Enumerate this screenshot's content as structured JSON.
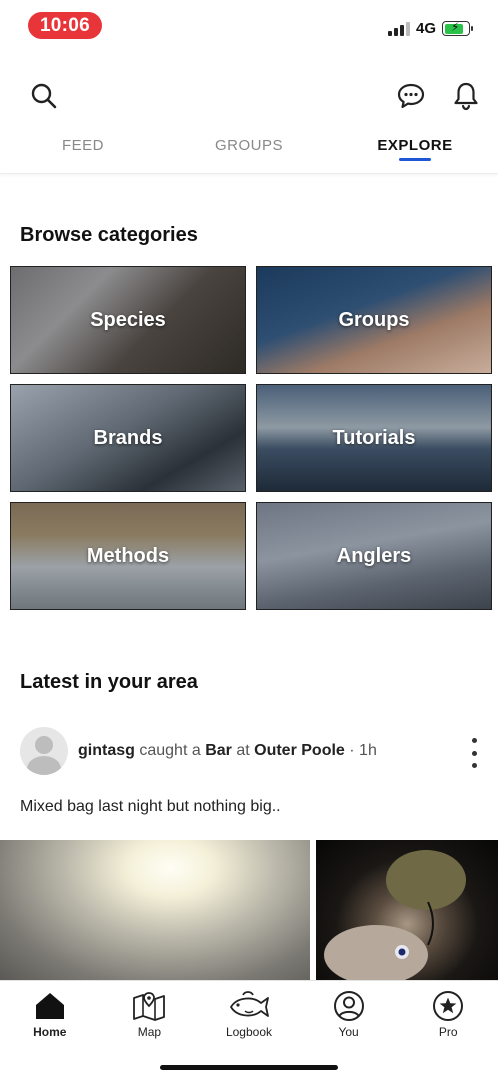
{
  "status": {
    "time": "10:06",
    "network": "4G",
    "battery_level": 0.8,
    "time_pill_color": "#e8353a",
    "battery_color": "#2bc24a"
  },
  "header": {
    "icons": [
      "search-icon",
      "chat-icon",
      "bell-icon"
    ]
  },
  "tabs": [
    {
      "label": "FEED",
      "active": false
    },
    {
      "label": "GROUPS",
      "active": false
    },
    {
      "label": "EXPLORE",
      "active": true
    }
  ],
  "accent_color": "#1f56d6",
  "browse": {
    "title": "Browse categories",
    "categories": [
      {
        "label": "Species"
      },
      {
        "label": "Groups"
      },
      {
        "label": "Brands"
      },
      {
        "label": "Tutorials"
      },
      {
        "label": "Methods"
      },
      {
        "label": "Anglers"
      }
    ]
  },
  "latest": {
    "title": "Latest in your area",
    "post": {
      "username": "gintasg",
      "verb1": "caught a",
      "species": "Bar",
      "verb2": "at",
      "location": "Outer Poole",
      "separator": "·",
      "time_ago": "1h",
      "caption": "Mixed bag last night but nothing big.."
    }
  },
  "bottom_nav": [
    {
      "label": "Home",
      "icon": "home-icon",
      "active": true
    },
    {
      "label": "Map",
      "icon": "map-icon",
      "active": false
    },
    {
      "label": "Logbook",
      "icon": "fish-logbook-icon",
      "active": false
    },
    {
      "label": "You",
      "icon": "profile-icon",
      "active": false
    },
    {
      "label": "Pro",
      "icon": "star-pro-icon",
      "active": false
    }
  ]
}
